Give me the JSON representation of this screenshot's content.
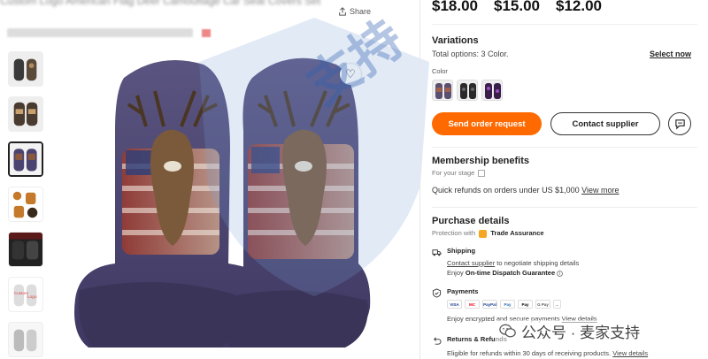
{
  "header": {
    "title_fragment": "Custom Logo American Flag Deer Camouflage Car Seat Covers Set",
    "share_label": "Share"
  },
  "gallery": {
    "thumbnail_count": 7,
    "active_index": 2
  },
  "pricing": {
    "tiers": [
      "$18.00",
      "$15.00",
      "$12.00"
    ]
  },
  "variations": {
    "title": "Variations",
    "total_options": "Total options: 3 Color.",
    "select_now": "Select now",
    "color_label": "Color",
    "swatches": [
      "deer-flag",
      "dark-camo",
      "purple-camo"
    ]
  },
  "actions": {
    "send_order": "Send order request",
    "contact_supplier": "Contact supplier"
  },
  "membership": {
    "title": "Membership benefits",
    "stage": "For your stage",
    "refund_text": "Quick refunds on orders under US $1,000",
    "view_more": "View more"
  },
  "purchase": {
    "title": "Purchase details",
    "protection_prefix": "Protection with",
    "trade_assurance": "Trade Assurance",
    "shipping_title": "Shipping",
    "shipping_link": "Contact supplier",
    "shipping_text": "to negotiate shipping details",
    "shipping_enjoy": "Enjoy",
    "shipping_guarantee": "On-time Dispatch Guarantee",
    "payments_title": "Payments",
    "payment_methods": [
      "VISA",
      "MC",
      "PayPal",
      "Pay",
      "Pay",
      "G Pay",
      "..."
    ],
    "payments_text": "Enjoy encrypted and secure payments",
    "payments_link": "View details",
    "returns_title": "Returns & Refunds",
    "returns_text": "Eligible for refunds within 30 days of receiving products.",
    "returns_link": "View details"
  },
  "watermark": {
    "text": "公众号 · 麦家支持",
    "brand_chars": "支持"
  },
  "colors": {
    "accent": "#ff6a00",
    "seat_purple": "#4b4470",
    "text": "#222222"
  }
}
